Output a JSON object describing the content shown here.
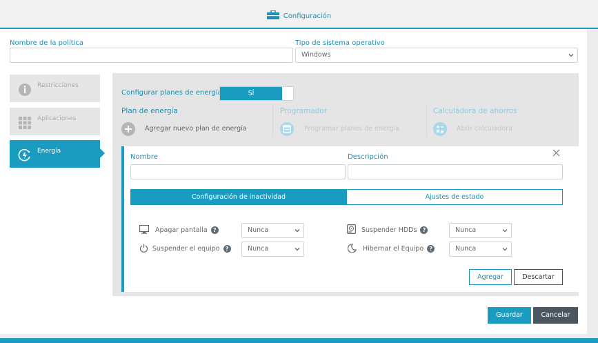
{
  "header": {
    "title": "Configuración"
  },
  "form": {
    "policy_name_label": "Nombre de la política",
    "policy_name_value": "",
    "os_label": "Tipo de sistema operativo",
    "os_value": "Windows"
  },
  "sidebar": {
    "items": [
      {
        "label": "Restricciones",
        "icon": "info-icon"
      },
      {
        "label": "Aplicaciones",
        "icon": "grid-icon"
      },
      {
        "label": "Energía",
        "icon": "energy-icon",
        "active": true
      }
    ]
  },
  "energy": {
    "configure_label": "Configurar planes de energía",
    "toggle_on_label": "SÍ",
    "columns": [
      {
        "heading": "Plan de energía",
        "action": "Agregar nuevo plan de energía"
      },
      {
        "heading": "Programador",
        "action": "Programar planes de energía"
      },
      {
        "heading": "Calculadora de ahorros",
        "action": "Abrir calculadora"
      }
    ]
  },
  "plan_card": {
    "name_label": "Nombre",
    "name_value": "",
    "description_label": "Descripción",
    "description_value": "",
    "tabs": [
      "Configuración de inactividad",
      "Ajustes de estado"
    ],
    "options": [
      {
        "label": "Apagar pantalla",
        "value": "Nunca",
        "icon": "monitor-icon"
      },
      {
        "label": "Suspender HDDs",
        "value": "Nunca",
        "icon": "hdd-icon"
      },
      {
        "label": "Suspender el equipo",
        "value": "Nunca",
        "icon": "power-icon"
      },
      {
        "label": "Hibernar el Equipo",
        "value": "Nunca",
        "icon": "moon-icon"
      }
    ],
    "add_label": "Agregar",
    "discard_label": "Descartar"
  },
  "footer": {
    "save_label": "Guardar",
    "cancel_label": "Cancelar"
  },
  "colors": {
    "accent": "#1a9cc1",
    "dark_button": "#4a5660",
    "panel_bg": "#e5e5e5"
  }
}
